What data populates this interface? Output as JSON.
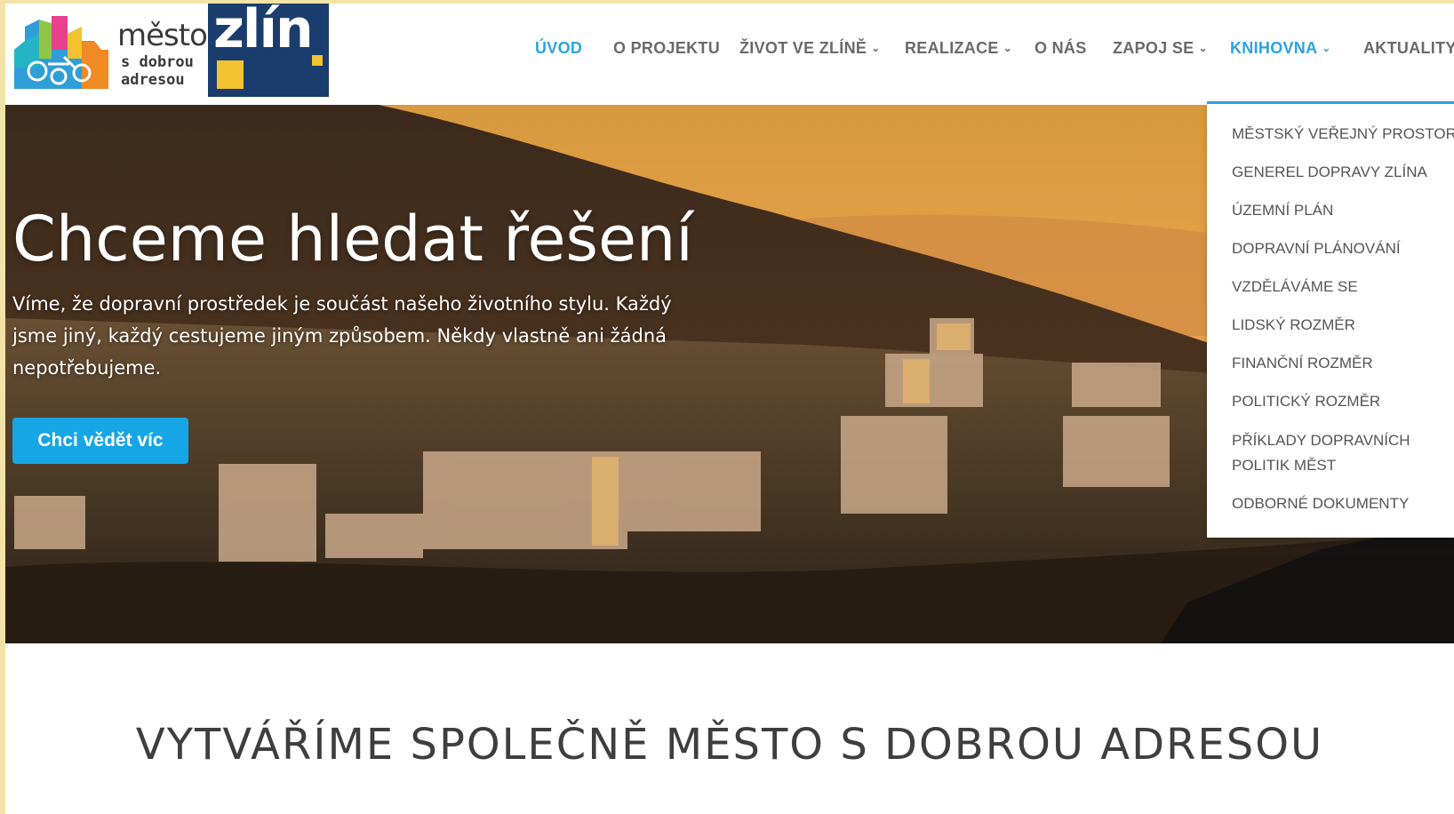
{
  "logo": {
    "mesto": "město",
    "line2": "s dobrou",
    "line3": "adresou",
    "zlin": "zlín"
  },
  "nav": {
    "items": [
      {
        "label": "ÚVOD",
        "active": true,
        "has_dropdown": false
      },
      {
        "label": "O PROJEKTU",
        "active": false,
        "has_dropdown": false
      },
      {
        "label": "ŽIVOT VE ZLÍNĚ",
        "active": false,
        "has_dropdown": true
      },
      {
        "label": "REALIZACE",
        "active": false,
        "has_dropdown": true
      },
      {
        "label": "O NÁS",
        "active": false,
        "has_dropdown": false
      },
      {
        "label": "ZAPOJ SE",
        "active": false,
        "has_dropdown": true
      },
      {
        "label": "KNIHOVNA",
        "active": true,
        "has_dropdown": true
      },
      {
        "label": "AKTUALITY",
        "active": false,
        "has_dropdown": false
      }
    ],
    "chevron_icon": "chevron-down-icon"
  },
  "hero": {
    "title": "Chceme hledat řešení",
    "text": "Víme, že dopravní prostředek je součást našeho životního stylu. Každý jsme jiný, každý cestujeme jiným způsobem. Někdy vlastně ani žádná nepotřebujeme.",
    "button": "Chci vědět víc"
  },
  "dropdown": {
    "items": [
      "MĚSTSKÝ VEŘEJNÝ PROSTOR",
      "GENEREL DOPRAVY ZLÍNA",
      "ÚZEMNÍ PLÁN",
      "DOPRAVNÍ PLÁNOVÁNÍ",
      "VZDĚLÁVÁME SE",
      "LIDSKÝ ROZMĚR",
      "FINANČNÍ ROZMĚR",
      "POLITICKÝ ROZMĚR",
      "PŘÍKLADY DOPRAVNÍCH",
      "POLITIK MĚST",
      "ODBORNÉ DOKUMENTY"
    ]
  },
  "section": {
    "title": "VYTVÁŘÍME SPOLEČNĚ MĚSTO S DOBROU ADRESOU"
  },
  "colors": {
    "accent": "#2ea3dc",
    "button": "#16a6e6",
    "zlin_blue": "#1b3d6d",
    "zlin_yellow": "#f2c230"
  }
}
